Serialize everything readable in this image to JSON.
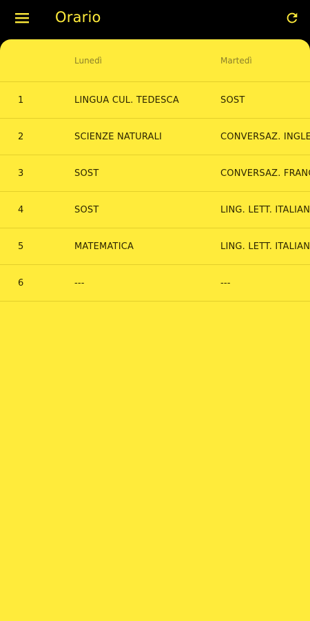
{
  "app": {
    "title": "Orario",
    "colors": {
      "topbar_bg": "#000000",
      "accent_yellow": "#FFEB3B",
      "header_text": "#8A7F2A",
      "cell_text": "#2B2400",
      "divider": "#E3CF2A"
    },
    "icons": {
      "menu": "hamburger-menu-icon",
      "refresh": "refresh-icon"
    }
  },
  "table": {
    "columns": [
      "",
      "Lunedì",
      "Martedì"
    ],
    "rows": [
      {
        "num": "1",
        "mon": "LINGUA CUL. TEDESCA",
        "tue": "SOST"
      },
      {
        "num": "2",
        "mon": "SCIENZE NATURALI",
        "tue": "CONVERSAZ. INGLESE"
      },
      {
        "num": "3",
        "mon": "SOST",
        "tue": "CONVERSAZ. FRANCESE"
      },
      {
        "num": "4",
        "mon": "SOST",
        "tue": "LING. LETT. ITALIANA"
      },
      {
        "num": "5",
        "mon": "MATEMATICA",
        "tue": "LING. LETT. ITALIANA"
      },
      {
        "num": "6",
        "mon": "---",
        "tue": "---"
      }
    ]
  }
}
